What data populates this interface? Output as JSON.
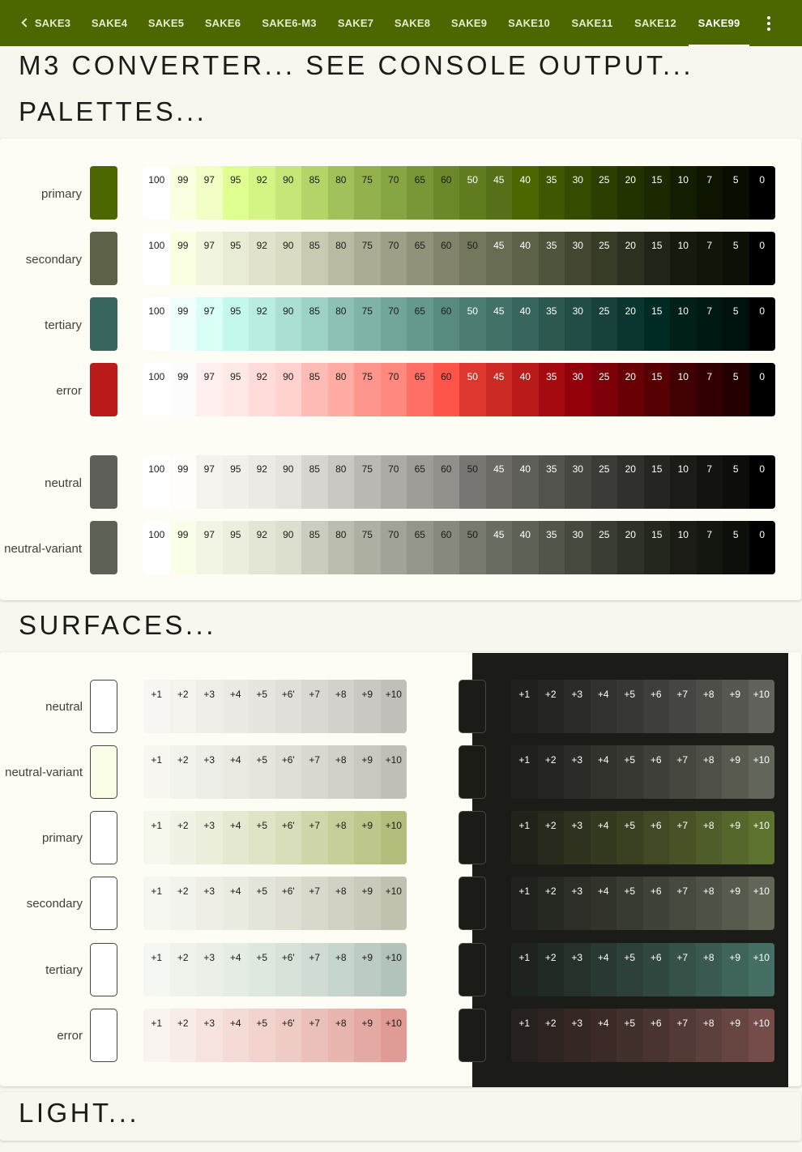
{
  "tabs": [
    "SAKE3",
    "SAKE4",
    "SAKE5",
    "SAKE6",
    "SAKE6-M3",
    "SAKE7",
    "SAKE8",
    "SAKE9",
    "SAKE10",
    "SAKE11",
    "SAKE12",
    "SAKE99"
  ],
  "active_tab": "SAKE99",
  "icons": {
    "back": "chevron-left-icon",
    "menu": "more-vert-icon"
  },
  "headings": {
    "converter": "M3 CONVERTER... SEE CONSOLE OUTPUT...",
    "palettes": "PALETTES...",
    "surfaces": "SURFACES...",
    "light": "LIGHT..."
  },
  "tone_labels": [
    "100",
    "99",
    "97",
    "95",
    "92",
    "90",
    "85",
    "80",
    "75",
    "70",
    "65",
    "60",
    "50",
    "45",
    "40",
    "35",
    "30",
    "25",
    "20",
    "15",
    "10",
    "7",
    "5",
    "0"
  ],
  "palettes": [
    {
      "label": "primary",
      "key": "#4c6700",
      "colors": [
        "#ffffff",
        "#f9ffe0",
        "#f0fec6",
        "#dfff90",
        "#d4f584",
        "#c6e777",
        "#b4d46a",
        "#a1c25a",
        "#93b24e",
        "#86a543",
        "#799736",
        "#6b892b",
        "#5f7c1f",
        "#557018",
        "#4c6700",
        "#3f5800",
        "#354b00",
        "#2c3f00",
        "#223300",
        "#1b2800",
        "#131d00",
        "#0d1500",
        "#090f00",
        "#000000"
      ]
    },
    {
      "label": "secondary",
      "key": "#5c6148",
      "colors": [
        "#ffffff",
        "#f9ffe0",
        "#f1f4df",
        "#e9ecd4",
        "#e0e2cb",
        "#d9dcc2",
        "#c8cbb2",
        "#b9bca2",
        "#aaad94",
        "#9da086",
        "#909379",
        "#82856c",
        "#73785d",
        "#676c52",
        "#5c6148",
        "#4f543c",
        "#434731",
        "#373c27",
        "#2c301e",
        "#212517",
        "#171b0e",
        "#12150a",
        "#0d1007",
        "#000000"
      ]
    },
    {
      "label": "tertiary",
      "key": "#38665e",
      "colors": [
        "#ffffff",
        "#f0fffb",
        "#d9fff7",
        "#c4f8ec",
        "#b9ede2",
        "#acdfd3",
        "#9cd1c6",
        "#8dc1b5",
        "#7fb3a7",
        "#72a59a",
        "#66998d",
        "#588b80",
        "#4b7d72",
        "#417167",
        "#38665e",
        "#2d5951",
        "#224d46",
        "#17413a",
        "#0b352f",
        "#002a24",
        "#002019",
        "#001813",
        "#00120f",
        "#000000"
      ]
    },
    {
      "label": "error",
      "key": "#ba1a1a",
      "colors": [
        "#ffffff",
        "#fcfcfc",
        "#fff0ef",
        "#ffe9e7",
        "#ffdcd9",
        "#ffd2cf",
        "#ffbcb6",
        "#ffaca5",
        "#ff968d",
        "#ff887f",
        "#ff6f65",
        "#ff544a",
        "#de3730",
        "#cc2a25",
        "#ba1a1a",
        "#a40a10",
        "#93000a",
        "#7e0008",
        "#690006",
        "#560004",
        "#410002",
        "#320002",
        "#240001",
        "#000000"
      ]
    },
    {
      "label": "neutral",
      "key": "#5f5f59",
      "colors": [
        "#ffffff",
        "#fefdf9",
        "#f4f3ee",
        "#f1f0eb",
        "#ebeae4",
        "#e5e4de",
        "#d6d5cf",
        "#c9c8c2",
        "#bab9b3",
        "#acaba6",
        "#9e9d98",
        "#91908b",
        "#787773",
        "#6b6a65",
        "#5f5f59",
        "#53534e",
        "#474742",
        "#3b3b37",
        "#30302c",
        "#252522",
        "#1b1c18",
        "#131311",
        "#0d0e0c",
        "#000000"
      ]
    },
    {
      "label": "neutral-variant",
      "key": "#5e6155",
      "colors": [
        "#ffffff",
        "#faffea",
        "#f2f4e4",
        "#ecefdd",
        "#e3e6d4",
        "#dcdfcd",
        "#cacdbd",
        "#bbbeaf",
        "#aeb0a2",
        "#a1a396",
        "#949689",
        "#86897b",
        "#777a6d",
        "#696c60",
        "#5e6155",
        "#52554a",
        "#46493e",
        "#3a3d33",
        "#2f3228",
        "#24271e",
        "#1a1c15",
        "#141610",
        "#0d0f0b",
        "#000000"
      ]
    }
  ],
  "surface_labels": [
    "+1",
    "+2",
    "+3",
    "+4",
    "+5",
    "+6'",
    "+7",
    "+8",
    "+9",
    "+10"
  ],
  "dark_surface_labels": [
    "+1",
    "+2",
    "+3",
    "+4",
    "+5",
    "+6",
    "+7",
    "+8",
    "+9",
    "+10"
  ],
  "surfaces": [
    {
      "label": "neutral",
      "base_light": "#ffffff",
      "base_dark": "#1b1c18",
      "light": [
        "#f8f7f3",
        "#f4f3ee",
        "#efeee8",
        "#eae9e3",
        "#e6e5df",
        "#e0dfd9",
        "#d9d8d2",
        "#d2d1cb",
        "#c9c8c2",
        "#c0bfb9"
      ],
      "dark": [
        "#20201d",
        "#252522",
        "#2b2b27",
        "#31312d",
        "#373733",
        "#3e3e3a",
        "#454541",
        "#4e4e49",
        "#575752",
        "#62625c"
      ]
    },
    {
      "label": "neutral-variant",
      "base_light": "#fbffe8",
      "base_dark": "#1a1c15",
      "light": [
        "#f8f7f2",
        "#f3f3ee",
        "#eeeee8",
        "#e9e9e2",
        "#e5e5de",
        "#dfdfd8",
        "#d8d8d1",
        "#d1d1ca",
        "#c8c8c1",
        "#bfbfb8"
      ],
      "dark": [
        "#20211c",
        "#252621",
        "#2b2c27",
        "#31322c",
        "#373832",
        "#3e3f38",
        "#46473f",
        "#4e5047",
        "#585a4f",
        "#62655a"
      ]
    },
    {
      "label": "primary",
      "base_light": "#ffffff",
      "base_dark": "#1b1c18",
      "light": [
        "#f6f7ed",
        "#f0f2e4",
        "#eaeeda",
        "#e5e9d1",
        "#dfe4c7",
        "#d8deba",
        "#cfd6aa",
        "#c6ce9a",
        "#bdc68b",
        "#b3bd7c"
      ],
      "dark": [
        "#21231a",
        "#272a1c",
        "#2e321e",
        "#343a20",
        "#3a4122",
        "#414a24",
        "#475326",
        "#4e5d29",
        "#56672c",
        "#5e7230"
      ]
    },
    {
      "label": "secondary",
      "base_light": "#ffffff",
      "base_dark": "#1b1c18",
      "light": [
        "#f7f7f2",
        "#f2f3ec",
        "#eeeee6",
        "#e9eae0",
        "#e4e5da",
        "#dfe0d3",
        "#d8d9cb",
        "#d1d2c3",
        "#c9cab9",
        "#c0c1af"
      ],
      "dark": [
        "#21221d",
        "#262822",
        "#2c2e27",
        "#32342c",
        "#383b32",
        "#3f4238",
        "#464a3e",
        "#4e5246",
        "#575b4e",
        "#616656"
      ]
    },
    {
      "label": "tertiary",
      "base_light": "#ffffff",
      "base_dark": "#1b1c18",
      "light": [
        "#f5f7f2",
        "#eff3ec",
        "#eaf0e8",
        "#e5ece4",
        "#dfe8df",
        "#d8e2d9",
        "#cfdbd3",
        "#c6d5cd",
        "#bcccc5",
        "#b2c3bc"
      ],
      "dark": [
        "#1f2320",
        "#222a26",
        "#26312c",
        "#293833",
        "#2d4039",
        "#314840",
        "#355148",
        "#3a5a51",
        "#3f645a",
        "#456e64"
      ]
    },
    {
      "label": "error",
      "base_light": "#ffffff",
      "base_dark": "#1b1c18",
      "light": [
        "#faf4f1",
        "#f8ece8",
        "#f6e3de",
        "#f4dbd5",
        "#f2d3cd",
        "#efcbc5",
        "#ecc0ba",
        "#e9b5af",
        "#e5a9a3",
        "#e19b96"
      ],
      "dark": [
        "#26201e",
        "#2d2321",
        "#342724",
        "#3b2a27",
        "#42302c",
        "#4a3431",
        "#533a36",
        "#5c403c",
        "#674642",
        "#744d4a"
      ]
    }
  ]
}
